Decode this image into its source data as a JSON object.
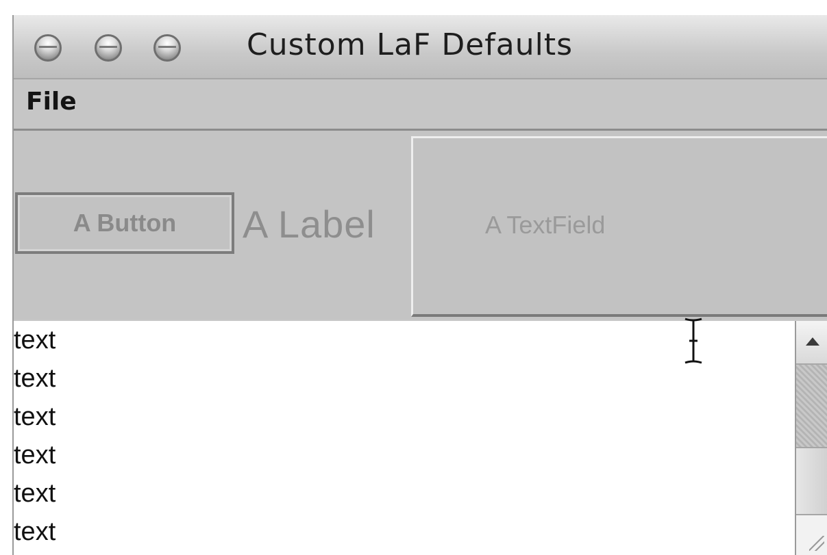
{
  "window": {
    "title": "Custom LaF Defaults"
  },
  "menubar": {
    "file_label": "File"
  },
  "controls": {
    "button_label": "A Button",
    "label_text": "A Label",
    "textfield_value": "A TextField"
  },
  "list": {
    "items": [
      "text",
      "text",
      "text",
      "text",
      "text",
      "text"
    ]
  },
  "icons": {
    "close": "close-button-icon",
    "minimize": "minimize-button-icon",
    "zoom": "zoom-button-icon",
    "cursor": "text-cursor-icon",
    "scroll_up": "scroll-up-arrow-icon",
    "resize": "resize-grip-icon"
  }
}
